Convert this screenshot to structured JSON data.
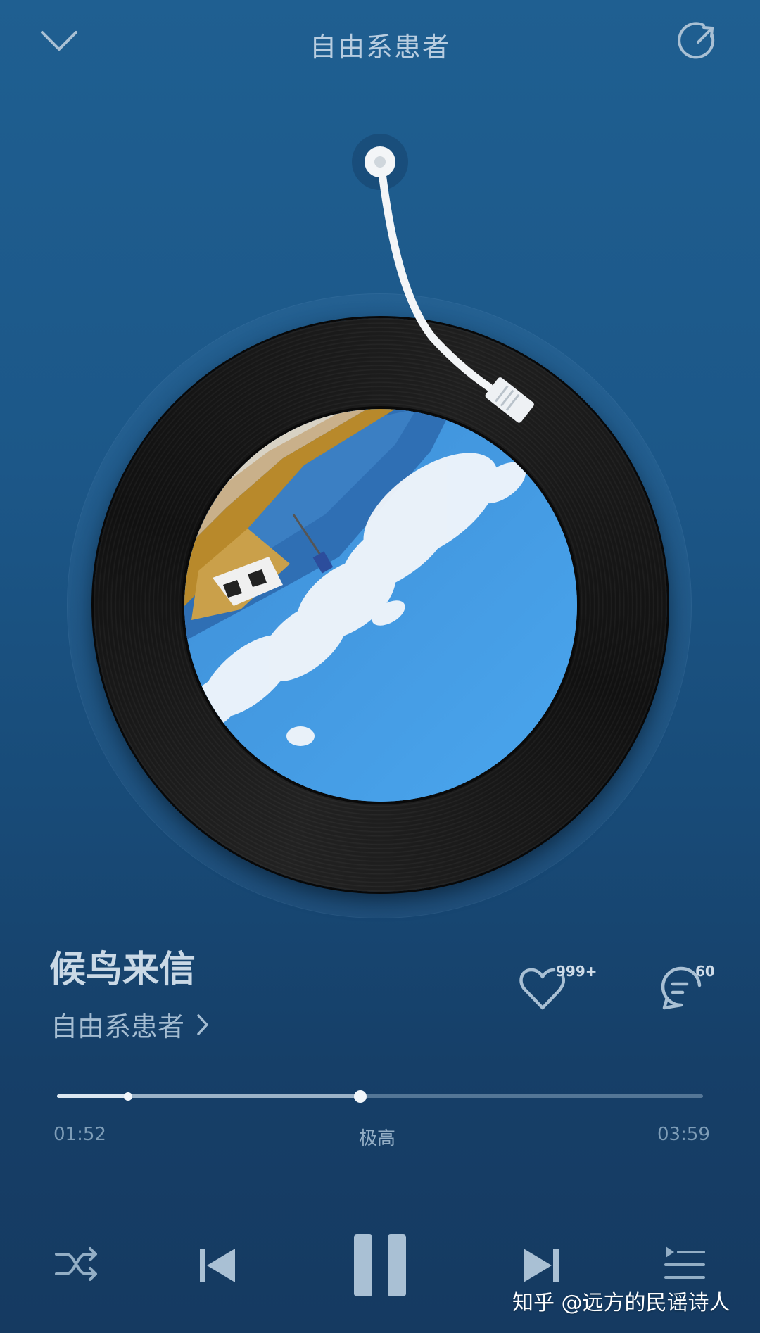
{
  "header": {
    "title": "自由系患者",
    "collapse_icon": "chevron-down-icon",
    "share_icon": "share-icon"
  },
  "player": {
    "cover_art": "sky-clouds-cover-image",
    "turntable": "vinyl-record"
  },
  "song": {
    "name": "候鸟来信",
    "artist": "自由系患者",
    "artist_arrow_icon": "chevron-right-icon"
  },
  "actions": {
    "like_icon": "heart-icon",
    "like_count": "999+",
    "comment_icon": "comment-icon",
    "comment_count": "60"
  },
  "progress": {
    "elapsed": "01:52",
    "quality": "极高",
    "duration": "03:59",
    "played_fraction": 0.11,
    "buffered_fraction": 0.47
  },
  "controls": {
    "shuffle_icon": "shuffle-icon",
    "previous_icon": "previous-icon",
    "pause_icon": "pause-icon",
    "next_icon": "next-icon",
    "playlist_icon": "playlist-icon"
  },
  "watermark": "知乎 @远方的民谣诗人",
  "colors": {
    "background_top": "#1f5f91",
    "background_bottom": "#153a61",
    "icon": "#a9c0d4",
    "text_primary": "#cad9e6"
  }
}
